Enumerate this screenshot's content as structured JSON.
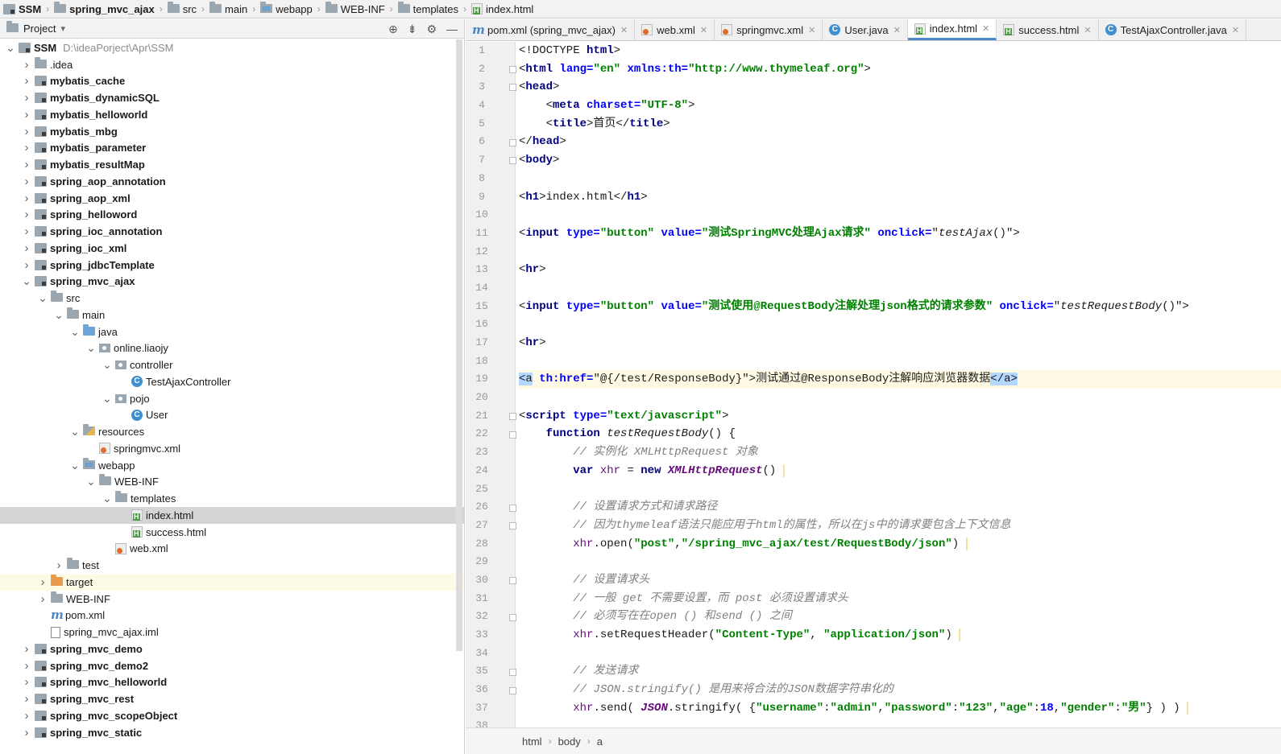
{
  "breadcrumb": [
    {
      "label": "SSM",
      "bold": true,
      "icon": "module-icon"
    },
    {
      "label": "spring_mvc_ajax",
      "bold": true,
      "icon": "module-folder-icon"
    },
    {
      "label": "src",
      "icon": "folder-icon"
    },
    {
      "label": "main",
      "icon": "folder-icon"
    },
    {
      "label": "webapp",
      "icon": "web-folder-icon"
    },
    {
      "label": "WEB-INF",
      "icon": "folder-icon"
    },
    {
      "label": "templates",
      "icon": "folder-icon"
    },
    {
      "label": "index.html",
      "icon": "html-file-icon"
    }
  ],
  "project_panel": {
    "title": "Project",
    "chevron": "▾"
  },
  "tree": [
    {
      "label": "SSM",
      "note": "D:\\ideaPorject\\Apr\\SSM",
      "icon": "module",
      "level": 0,
      "arrow": "v",
      "bold": true
    },
    {
      "label": ".idea",
      "icon": "folder",
      "level": 1,
      "arrow": ">"
    },
    {
      "label": "mybatis_cache",
      "icon": "module",
      "level": 1,
      "arrow": ">",
      "bold": true
    },
    {
      "label": "mybatis_dynamicSQL",
      "icon": "module",
      "level": 1,
      "arrow": ">",
      "bold": true
    },
    {
      "label": "mybatis_helloworld",
      "icon": "module",
      "level": 1,
      "arrow": ">",
      "bold": true
    },
    {
      "label": "mybatis_mbg",
      "icon": "module",
      "level": 1,
      "arrow": ">",
      "bold": true
    },
    {
      "label": "mybatis_parameter",
      "icon": "module",
      "level": 1,
      "arrow": ">",
      "bold": true
    },
    {
      "label": "mybatis_resultMap",
      "icon": "module",
      "level": 1,
      "arrow": ">",
      "bold": true
    },
    {
      "label": "spring_aop_annotation",
      "icon": "module",
      "level": 1,
      "arrow": ">",
      "bold": true
    },
    {
      "label": "spring_aop_xml",
      "icon": "module",
      "level": 1,
      "arrow": ">",
      "bold": true
    },
    {
      "label": "spring_helloword",
      "icon": "module",
      "level": 1,
      "arrow": ">",
      "bold": true
    },
    {
      "label": "spring_ioc_annotation",
      "icon": "module",
      "level": 1,
      "arrow": ">",
      "bold": true
    },
    {
      "label": "spring_ioc_xml",
      "icon": "module",
      "level": 1,
      "arrow": ">",
      "bold": true
    },
    {
      "label": "spring_jdbcTemplate",
      "icon": "module",
      "level": 1,
      "arrow": ">",
      "bold": true
    },
    {
      "label": "spring_mvc_ajax",
      "icon": "module",
      "level": 1,
      "arrow": "v",
      "bold": true
    },
    {
      "label": "src",
      "icon": "folder",
      "level": 2,
      "arrow": "v"
    },
    {
      "label": "main",
      "icon": "folder",
      "level": 3,
      "arrow": "v"
    },
    {
      "label": "java",
      "icon": "folder-blue",
      "level": 4,
      "arrow": "v"
    },
    {
      "label": "online.liaojy",
      "icon": "package",
      "level": 5,
      "arrow": "v"
    },
    {
      "label": "controller",
      "icon": "package",
      "level": 6,
      "arrow": "v"
    },
    {
      "label": "TestAjaxController",
      "icon": "class",
      "level": 7,
      "arrow": ""
    },
    {
      "label": "pojo",
      "icon": "package",
      "level": 6,
      "arrow": "v"
    },
    {
      "label": "User",
      "icon": "class",
      "level": 7,
      "arrow": ""
    },
    {
      "label": "resources",
      "icon": "folder-res",
      "level": 4,
      "arrow": "v"
    },
    {
      "label": "springmvc.xml",
      "icon": "xml",
      "level": 5,
      "arrow": ""
    },
    {
      "label": "webapp",
      "icon": "folder-web",
      "level": 4,
      "arrow": "v"
    },
    {
      "label": "WEB-INF",
      "icon": "folder",
      "level": 5,
      "arrow": "v"
    },
    {
      "label": "templates",
      "icon": "folder",
      "level": 6,
      "arrow": "v"
    },
    {
      "label": "index.html",
      "icon": "html",
      "level": 7,
      "arrow": "",
      "selected": true
    },
    {
      "label": "success.html",
      "icon": "html",
      "level": 7,
      "arrow": ""
    },
    {
      "label": "web.xml",
      "icon": "xml",
      "level": 6,
      "arrow": ""
    },
    {
      "label": "test",
      "icon": "folder",
      "level": 3,
      "arrow": ">"
    },
    {
      "label": "target",
      "icon": "folder-orange",
      "level": 2,
      "arrow": ">",
      "highlight": true
    },
    {
      "label": "WEB-INF",
      "icon": "folder",
      "level": 2,
      "arrow": ">"
    },
    {
      "label": "pom.xml",
      "icon": "maven",
      "level": 2,
      "arrow": ""
    },
    {
      "label": "spring_mvc_ajax.iml",
      "icon": "iml",
      "level": 2,
      "arrow": ""
    },
    {
      "label": "spring_mvc_demo",
      "icon": "module",
      "level": 1,
      "arrow": ">",
      "bold": true
    },
    {
      "label": "spring_mvc_demo2",
      "icon": "module",
      "level": 1,
      "arrow": ">",
      "bold": true
    },
    {
      "label": "spring_mvc_helloworld",
      "icon": "module",
      "level": 1,
      "arrow": ">",
      "bold": true
    },
    {
      "label": "spring_mvc_rest",
      "icon": "module",
      "level": 1,
      "arrow": ">",
      "bold": true
    },
    {
      "label": "spring_mvc_scopeObject",
      "icon": "module",
      "level": 1,
      "arrow": ">",
      "bold": true
    },
    {
      "label": "spring_mvc_static",
      "icon": "module",
      "level": 1,
      "arrow": ">",
      "bold": true
    }
  ],
  "tabs": [
    {
      "label": "pom.xml (spring_mvc_ajax)",
      "icon": "maven"
    },
    {
      "label": "web.xml",
      "icon": "xml"
    },
    {
      "label": "springmvc.xml",
      "icon": "xml"
    },
    {
      "label": "User.java",
      "icon": "class"
    },
    {
      "label": "index.html",
      "icon": "html",
      "active": true
    },
    {
      "label": "success.html",
      "icon": "html"
    },
    {
      "label": "TestAjaxController.java",
      "icon": "class"
    }
  ],
  "tab_close": "✕",
  "line_numbers": [
    "1",
    "2",
    "3",
    "4",
    "5",
    "6",
    "7",
    "8",
    "9",
    "10",
    "11",
    "12",
    "13",
    "14",
    "15",
    "16",
    "17",
    "18",
    "19",
    "20",
    "21",
    "22",
    "23",
    "24",
    "25",
    "26",
    "27",
    "28",
    "29",
    "30",
    "31",
    "32",
    "33",
    "34",
    "35",
    "36",
    "37",
    "38"
  ],
  "code": [
    [
      [
        "t",
        "<!DOCTYPE "
      ],
      [
        "k",
        "html"
      ],
      [
        "t",
        ">"
      ]
    ],
    [
      [
        "t",
        "<"
      ],
      [
        "k",
        "html "
      ],
      [
        "at",
        "lang="
      ],
      [
        "s",
        "\"en\" "
      ],
      [
        "at",
        "xmlns:th="
      ],
      [
        "s",
        "\"http://www.thymeleaf.org\""
      ],
      [
        "t",
        ">"
      ]
    ],
    [
      [
        "t",
        "<"
      ],
      [
        "k",
        "head"
      ],
      [
        "t",
        ">"
      ]
    ],
    [
      [
        "t",
        "    <"
      ],
      [
        "k",
        "meta "
      ],
      [
        "at",
        "charset="
      ],
      [
        "s",
        "\"UTF-8\""
      ],
      [
        "t",
        ">"
      ]
    ],
    [
      [
        "t",
        "    <"
      ],
      [
        "k",
        "title"
      ],
      [
        "t",
        ">首页</"
      ],
      [
        "k",
        "title"
      ],
      [
        "t",
        ">"
      ]
    ],
    [
      [
        "t",
        "</"
      ],
      [
        "k",
        "head"
      ],
      [
        "t",
        ">"
      ]
    ],
    [
      [
        "t",
        "<"
      ],
      [
        "k",
        "body"
      ],
      [
        "t",
        ">"
      ]
    ],
    [],
    [
      [
        "t",
        "<"
      ],
      [
        "k",
        "h1"
      ],
      [
        "t",
        ">index.html</"
      ],
      [
        "k",
        "h1"
      ],
      [
        "t",
        ">"
      ]
    ],
    [],
    [
      [
        "t",
        "<"
      ],
      [
        "k",
        "input "
      ],
      [
        "at",
        "type="
      ],
      [
        "s",
        "\"button\" "
      ],
      [
        "at",
        "value="
      ],
      [
        "s",
        "\"测试SpringMVC处理Ajax请求\" "
      ],
      [
        "at",
        "onclick="
      ],
      [
        "t",
        "\""
      ],
      [
        "it",
        "testAjax"
      ],
      [
        "t",
        "()\">"
      ]
    ],
    [],
    [
      [
        "t",
        "<"
      ],
      [
        "k",
        "hr"
      ],
      [
        "t",
        ">"
      ]
    ],
    [],
    [
      [
        "t",
        "<"
      ],
      [
        "k",
        "input "
      ],
      [
        "at",
        "type="
      ],
      [
        "s",
        "\"button\" "
      ],
      [
        "at",
        "value="
      ],
      [
        "s",
        "\"测试使用@RequestBody注解处理json格式的请求参数\" "
      ],
      [
        "at",
        "onclick="
      ],
      [
        "t",
        "\""
      ],
      [
        "it",
        "testRequestBody"
      ],
      [
        "t",
        "()\">"
      ]
    ],
    [],
    [
      [
        "t",
        "<"
      ],
      [
        "k",
        "hr"
      ],
      [
        "t",
        ">"
      ]
    ],
    [],
    [
      [
        "hlt",
        "<a"
      ],
      [
        "t",
        " "
      ],
      [
        "at",
        "th:href="
      ],
      [
        "t",
        "\"@{/test/ResponseBody}\">测试通过@ResponseBody注解响应浏览器数据"
      ],
      [
        "hlt",
        "</a>"
      ]
    ],
    [],
    [
      [
        "t",
        "<"
      ],
      [
        "k",
        "script "
      ],
      [
        "at",
        "type="
      ],
      [
        "s",
        "\"text/javascript\""
      ],
      [
        "t",
        ">"
      ]
    ],
    [
      [
        "t",
        "    "
      ],
      [
        "k",
        "function "
      ],
      [
        "it",
        "testRequestBody"
      ],
      [
        "t",
        "() {"
      ]
    ],
    [
      [
        "t",
        "        "
      ],
      [
        "cm",
        "// 实例化 XMLHttpRequest 对象"
      ]
    ],
    [
      [
        "t",
        "        "
      ],
      [
        "k",
        "var "
      ],
      [
        "mv",
        "xhr"
      ],
      [
        "t",
        " = "
      ],
      [
        "k",
        "new "
      ],
      [
        "th",
        "XMLHttpRequest"
      ],
      [
        "t",
        "()"
      ],
      [
        "cur",
        " "
      ]
    ],
    [],
    [
      [
        "t",
        "        "
      ],
      [
        "cm",
        "// 设置请求方式和请求路径"
      ]
    ],
    [
      [
        "t",
        "        "
      ],
      [
        "cm",
        "// 因为thymeleaf语法只能应用于html的属性，所以在js中的请求要包含上下文信息"
      ]
    ],
    [
      [
        "t",
        "        "
      ],
      [
        "mv",
        "xhr"
      ],
      [
        "t",
        ".open("
      ],
      [
        "s",
        "\"post\""
      ],
      [
        "t",
        ","
      ],
      [
        "s",
        "\"/spring_mvc_ajax/test/RequestBody/json\""
      ],
      [
        "t",
        ")"
      ],
      [
        "cur",
        " "
      ]
    ],
    [],
    [
      [
        "t",
        "        "
      ],
      [
        "cm",
        "// 设置请求头"
      ]
    ],
    [
      [
        "t",
        "        "
      ],
      [
        "cm",
        "// 一般 get 不需要设置，而 post 必须设置请求头"
      ]
    ],
    [
      [
        "t",
        "        "
      ],
      [
        "cm",
        "// 必须写在在open () 和send () 之间"
      ]
    ],
    [
      [
        "t",
        "        "
      ],
      [
        "mv",
        "xhr"
      ],
      [
        "t",
        ".setRequestHeader("
      ],
      [
        "s",
        "\"Content-Type\""
      ],
      [
        "t",
        ", "
      ],
      [
        "s",
        "\"application/json\""
      ],
      [
        "t",
        ")"
      ],
      [
        "cur",
        " "
      ]
    ],
    [],
    [
      [
        "t",
        "        "
      ],
      [
        "cm",
        "// 发送请求"
      ]
    ],
    [
      [
        "t",
        "        "
      ],
      [
        "cm",
        "// JSON.stringify() 是用来将合法的JSON数据字符串化的"
      ]
    ],
    [
      [
        "t",
        "        "
      ],
      [
        "mv",
        "xhr"
      ],
      [
        "t",
        ".send( "
      ],
      [
        "th",
        "JSON"
      ],
      [
        "t",
        ".stringify( {"
      ],
      [
        "s",
        "\"username\""
      ],
      [
        "t",
        ":"
      ],
      [
        "s",
        "\"admin\""
      ],
      [
        "t",
        ","
      ],
      [
        "s",
        "\"password\""
      ],
      [
        "t",
        ":"
      ],
      [
        "s",
        "\"123\""
      ],
      [
        "t",
        ","
      ],
      [
        "s",
        "\"age\""
      ],
      [
        "t",
        ":"
      ],
      [
        "at",
        "18"
      ],
      [
        "t",
        ","
      ],
      [
        "s",
        "\"gender\""
      ],
      [
        "t",
        ":"
      ],
      [
        "s",
        "\"男\""
      ],
      [
        "t",
        "} ) )"
      ],
      [
        "cur",
        " "
      ]
    ],
    []
  ],
  "status_path": [
    "html",
    "body",
    "a"
  ]
}
